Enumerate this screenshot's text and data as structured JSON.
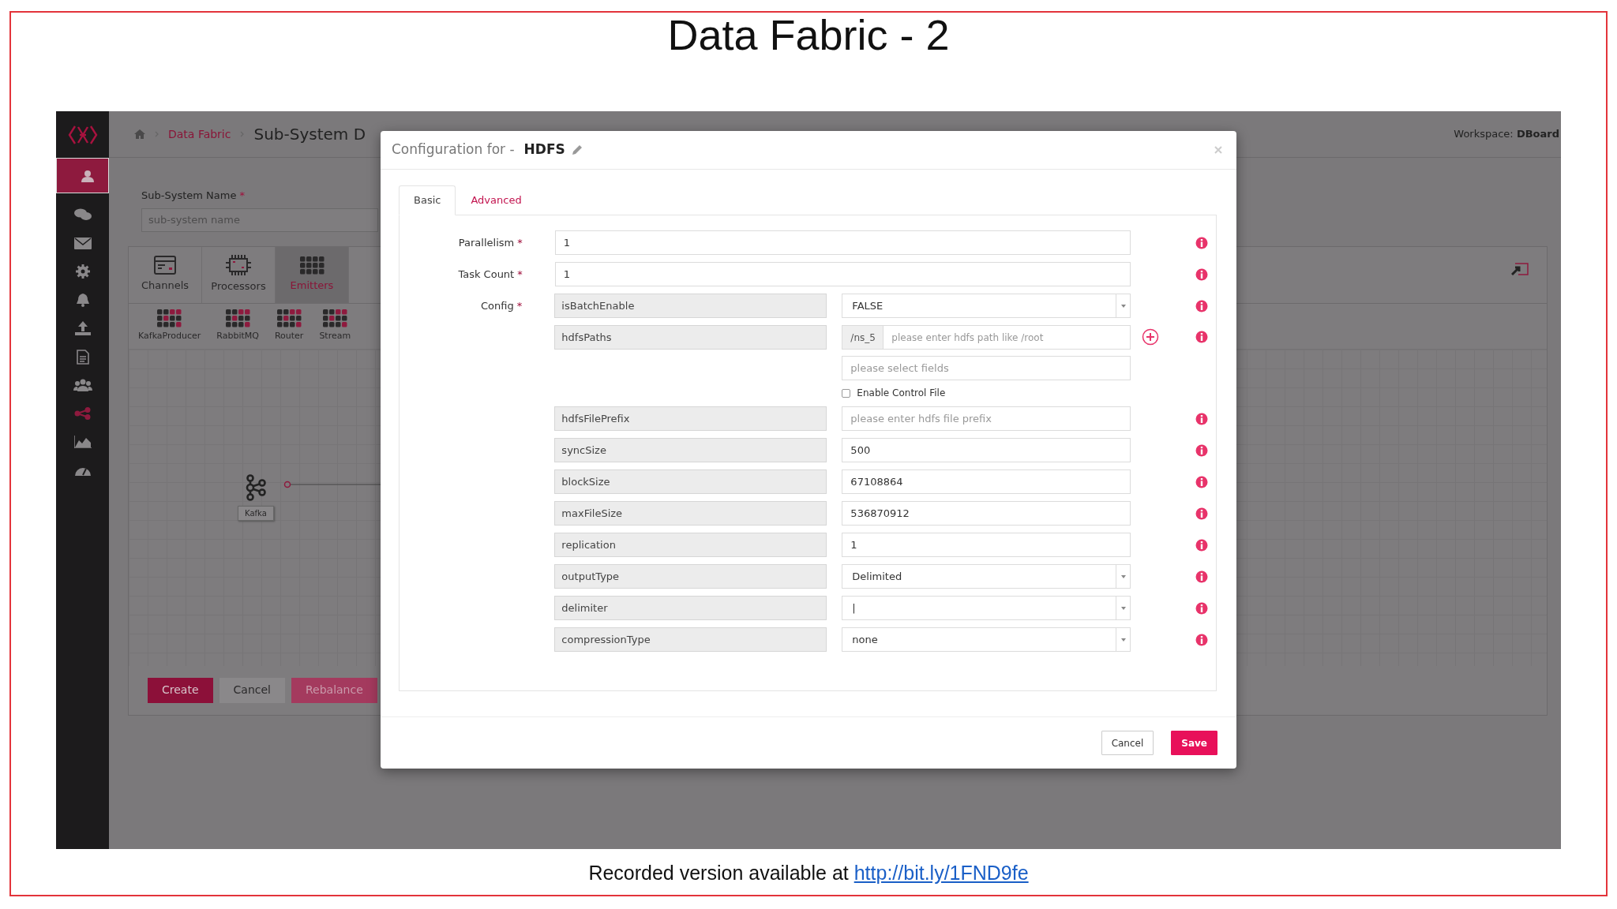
{
  "slide": {
    "title": "Data Fabric - 2",
    "caption": "Recorded version available at ",
    "caption_link": "http://bit.ly/1FND9fe"
  },
  "app": {
    "sidebar": {
      "items": [
        {
          "selected": true,
          "active": false
        },
        {
          "selected": false,
          "active": false
        },
        {
          "selected": false,
          "active": false
        },
        {
          "selected": false,
          "active": false
        },
        {
          "selected": false,
          "active": false
        },
        {
          "selected": false,
          "active": false
        },
        {
          "selected": false,
          "active": false
        },
        {
          "selected": false,
          "active": false
        },
        {
          "selected": false,
          "active": true
        },
        {
          "selected": false,
          "active": false
        },
        {
          "selected": false,
          "active": false
        }
      ]
    },
    "breadcrumb": [
      {
        "label": "Data Fabric"
      }
    ],
    "page_title": "Sub-System D",
    "workspace": "Workspace: **DBoard**",
    "name_field": {
      "label": "Sub-System Name",
      "mark": "*",
      "placeholder": "sub-system name"
    },
    "palette_tabs": [
      {
        "label": "Channels",
        "selected": false
      },
      {
        "label": "Processors",
        "selected": false
      },
      {
        "label": "Emitters",
        "selected": true
      }
    ],
    "palette_items": [
      {
        "label": "KafkaProducer"
      },
      {
        "label": "RabbitMQ"
      },
      {
        "label": "Router"
      },
      {
        "label": "Stream"
      }
    ],
    "canvas_nodes": [
      {
        "label": "Kafka"
      }
    ],
    "actions": [
      {
        "label": "Create",
        "kind": "primary"
      },
      {
        "label": "Cancel",
        "kind": "default"
      },
      {
        "label": "Rebalance",
        "kind": "secondary"
      }
    ]
  },
  "modal": {
    "title_prefix": "Configuration for -",
    "title": "HDFS",
    "tabs": [
      {
        "label": "Basic",
        "selected": true
      },
      {
        "label": "Advanced",
        "selected": false
      }
    ],
    "fields": [
      {
        "label": "Parallelism",
        "mark": "*",
        "value": "1"
      },
      {
        "label": "Task Count",
        "mark": "*",
        "value": "1"
      }
    ],
    "config_label": "Config",
    "config_mark": "*",
    "config": [
      {
        "key": "isBatchEnable",
        "kind": "select",
        "value": "FALSE"
      },
      {
        "key": "hdfsPaths",
        "kind": "path",
        "prefix": "/ns_5",
        "placeholder": "please enter hdfs path like /root",
        "extra_placeholder": "please select fields",
        "checkbox": {
          "label": "Enable Control File",
          "checked": false
        }
      },
      {
        "key": "hdfsFilePrefix",
        "kind": "text",
        "placeholder": "please enter hdfs file prefix"
      },
      {
        "key": "syncSize",
        "kind": "text",
        "value": "500"
      },
      {
        "key": "blockSize",
        "kind": "text",
        "value": "67108864"
      },
      {
        "key": "maxFileSize",
        "kind": "text",
        "value": "536870912"
      },
      {
        "key": "replication",
        "kind": "text",
        "value": "1"
      },
      {
        "key": "outputType",
        "kind": "select",
        "value": "Delimited"
      },
      {
        "key": "delimiter",
        "kind": "select",
        "value": "|"
      },
      {
        "key": "compressionType",
        "kind": "select",
        "value": "none"
      }
    ],
    "buttons": [
      {
        "label": "Cancel",
        "kind": "default"
      },
      {
        "label": "Save",
        "kind": "primary"
      }
    ]
  }
}
